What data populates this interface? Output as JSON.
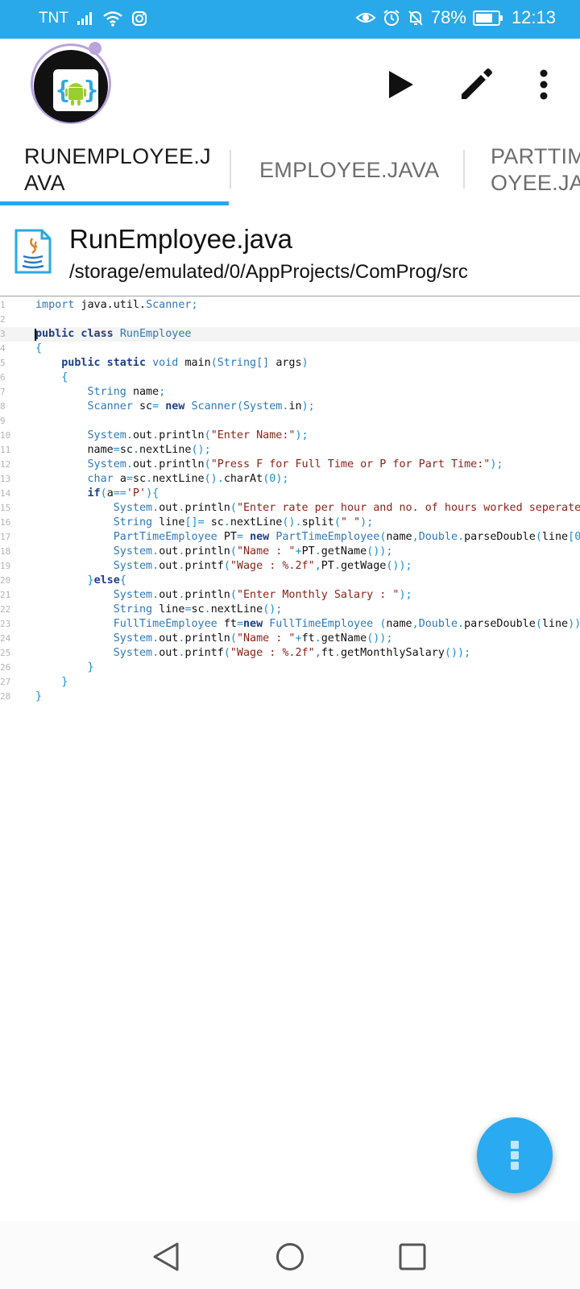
{
  "status_bar": {
    "carrier": "TNT",
    "battery": "78%",
    "battery_level": 0.78,
    "time": "12:13",
    "icons": [
      "signal-icon",
      "wifi-icon",
      "instagram-icon",
      "eye-icon",
      "alarm-icon",
      "mute-bell-icon",
      "battery-icon"
    ]
  },
  "app_bar": {
    "logo": "aide-android-logo",
    "actions": [
      "run-icon",
      "edit-icon",
      "more-vert-icon"
    ]
  },
  "tabs": [
    {
      "line1": "RUNEMPLOYEE.J",
      "line2": "AVA",
      "active": true
    },
    {
      "line1": "EMPLOYEE.JAVA",
      "line2": "",
      "active": false
    },
    {
      "line1": "PARTTIM",
      "line2": "OYEE.JA",
      "active": false
    }
  ],
  "file": {
    "name": "RunEmployee.java",
    "path": "/storage/emulated/0/AppProjects/ComProg/src"
  },
  "editor": {
    "line_numbers": [
      "1",
      "2",
      "3",
      "4",
      "5",
      "6",
      "7",
      "8",
      "9",
      "10",
      "11",
      "12",
      "13",
      "14",
      "15",
      "16",
      "17",
      "18",
      "19",
      "20",
      "21",
      "22",
      "23",
      "24",
      "25",
      "26",
      "27",
      "28"
    ],
    "current_line": 3
  },
  "colors": {
    "accent": "#29a9e9",
    "keyword": "#1d3f86",
    "type": "#2f78b8",
    "string": "#8b2318"
  },
  "fab": {
    "icon": "more-vert-icon"
  },
  "nav_bar": {
    "icons": [
      "back-icon",
      "home-icon",
      "recents-icon"
    ]
  }
}
